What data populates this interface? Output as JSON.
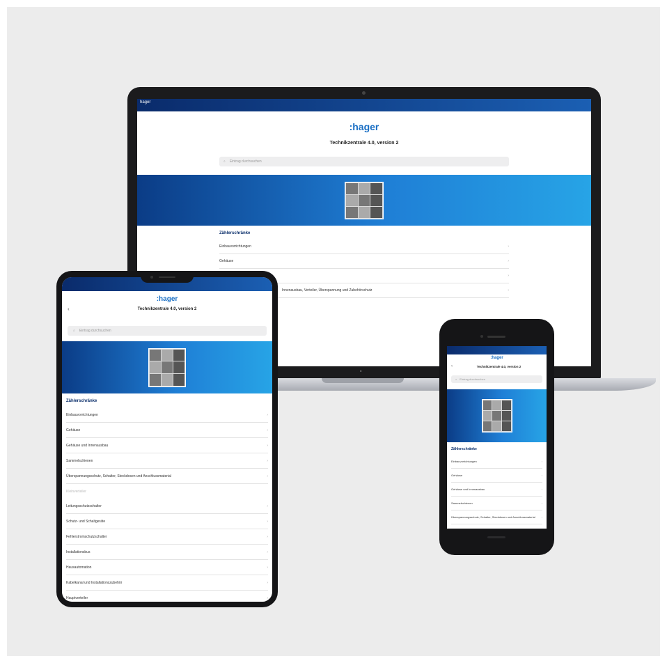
{
  "app": {
    "bar_label": "hager",
    "logo": ":hager",
    "title": "Technikzentrale 4.0, version 2",
    "search_placeholder": "Eintrag durchsuchen"
  },
  "laptop": {
    "section_title": "Zählerschränke",
    "items": [
      "Einbauvorrichtungen",
      "Gehäuse",
      "Innenausbau, Verteiler, Überspannung und Zubehörschutz"
    ]
  },
  "tablet": {
    "section_title": "Zählerschränke",
    "items": [
      "Einbauvorrichtungen",
      "Gehäuse",
      "Gehäuse und Innenausbau",
      "Sammelschienen",
      "Überspannungsschutz, Schalter, Steckdosen und Anschlussmaterial",
      "Leitungsschutzschalter",
      "Schutz- und Schaltgeräte",
      "Fehlerstromschutzschalter",
      "Installationsbus",
      "Hausautomation",
      "Kabelkanal und Installationszubehör",
      "Hauptverteiler"
    ],
    "muted_item": "Kleinverteiler"
  },
  "phone": {
    "section_title": "Zählerschränke",
    "items": [
      "Einbauvorrichtungen",
      "Gehäuse",
      "Gehäuse und Innenausbau",
      "Sammelschienen",
      "Überspannungsschutz, Schalter, Steckdosen und Anschlussmaterial"
    ]
  },
  "icons": {
    "chevron": "›",
    "back": "‹",
    "search": "⌕"
  },
  "colors": {
    "brand": "#1a6fc4",
    "topbar": "#0a2b6b",
    "banner_start": "#0b3c86",
    "banner_end": "#27a4e6",
    "background": "#ececec"
  }
}
